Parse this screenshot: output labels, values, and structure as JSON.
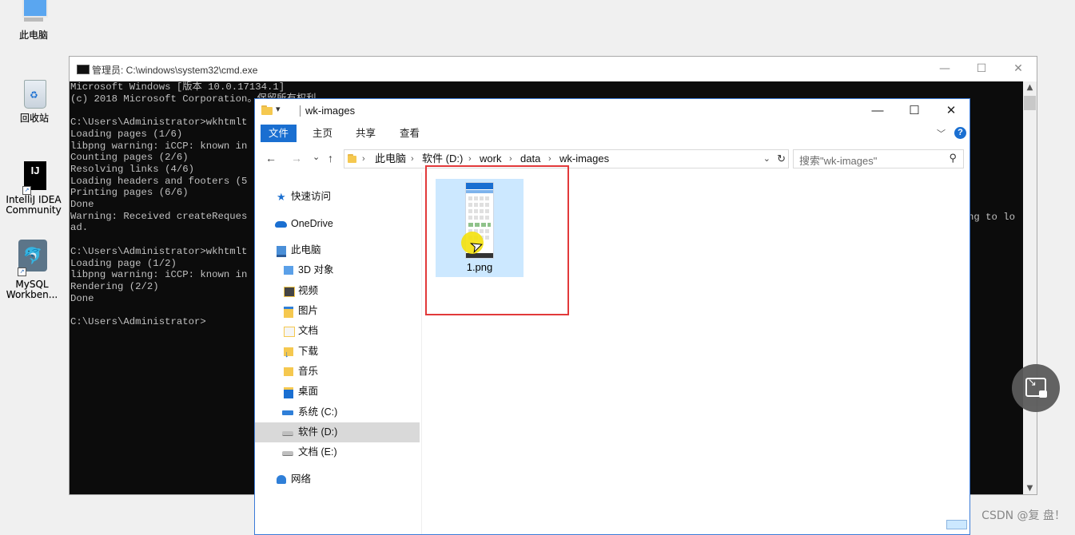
{
  "desktop": {
    "icons": [
      {
        "label": "此电脑",
        "icon": "computer-icon"
      },
      {
        "label": "回收站",
        "icon": "recycle-bin-icon"
      },
      {
        "label": "IntelliJ IDEA Community",
        "line1": "IntelliJ IDEA",
        "line2": "Community",
        "badge": "IJ",
        "icon": "intellij-idea-icon"
      },
      {
        "label": "MySQL Workben...",
        "line1": "MySQL",
        "line2": "Workben...",
        "icon": "mysql-workbench-icon"
      }
    ]
  },
  "cmd": {
    "title": "管理员: C:\\windows\\system32\\cmd.exe",
    "lines": [
      "Microsoft Windows [版本 10.0.17134.1]",
      "(c) 2018 Microsoft Corporation。保留所有权利。",
      "",
      "C:\\Users\\Administrator>wkhtmlt",
      "Loading pages (1/6)",
      "libpng warning: iCCP: known in",
      "Counting pages (2/6)",
      "Resolving links (4/6)",
      "Loading headers and footers (5",
      "Printing pages (6/6)",
      "Done",
      "Warning: Received createReques",
      "ad.",
      "",
      "C:\\Users\\Administrator>wkhtmlt",
      "Loading page (1/2)",
      "libpng warning: iCCP: known in",
      "Rendering (2/2)",
      "Done",
      "",
      "C:\\Users\\Administrator>"
    ],
    "right_text": "ng to lo",
    "minimize": "—",
    "maximize": "☐",
    "close": "✕"
  },
  "explorer": {
    "title": "wk-images",
    "quick_access_arrow": "▾",
    "minimize": "—",
    "maximize": "☐",
    "close": "✕",
    "ribbon": {
      "file": "文件",
      "home": "主页",
      "share": "共享",
      "view": "查看",
      "expand": "﹀",
      "help": "?"
    },
    "nav": {
      "back": "←",
      "forward": "→",
      "recent": "⌄",
      "up": "↑"
    },
    "breadcrumb": [
      "此电脑",
      "软件 (D:)",
      "work",
      "data",
      "wk-images"
    ],
    "crumb_sep": "›",
    "dropdown": "⌄",
    "refresh": "↻",
    "search_placeholder": "搜索\"wk-images\"",
    "search_icon": "⚲",
    "sidebar": [
      {
        "label": "快速访问",
        "icon": "star-icon"
      },
      {
        "label": "OneDrive",
        "icon": "cloud-icon"
      },
      {
        "label": "此电脑",
        "icon": "computer-icon"
      },
      {
        "label": "3D 对象",
        "icon": "3d-objects-icon"
      },
      {
        "label": "视频",
        "icon": "video-icon"
      },
      {
        "label": "图片",
        "icon": "pictures-icon"
      },
      {
        "label": "文档",
        "icon": "documents-icon"
      },
      {
        "label": "下载",
        "icon": "download-icon"
      },
      {
        "label": "音乐",
        "icon": "music-icon"
      },
      {
        "label": "桌面",
        "icon": "desktop-icon"
      },
      {
        "label": "系统 (C:)",
        "icon": "system-drive-icon"
      },
      {
        "label": "软件 (D:)",
        "icon": "drive-icon",
        "selected": true
      },
      {
        "label": "文档 (E:)",
        "icon": "drive-icon"
      },
      {
        "label": "网络",
        "icon": "network-icon"
      }
    ],
    "files": [
      {
        "name": "1.png"
      }
    ]
  },
  "watermark": "CSDN @复 盘！",
  "colors": {
    "accent": "#1a6fd1",
    "highlight_border": "#e2393a",
    "selection": "#cce8ff"
  }
}
